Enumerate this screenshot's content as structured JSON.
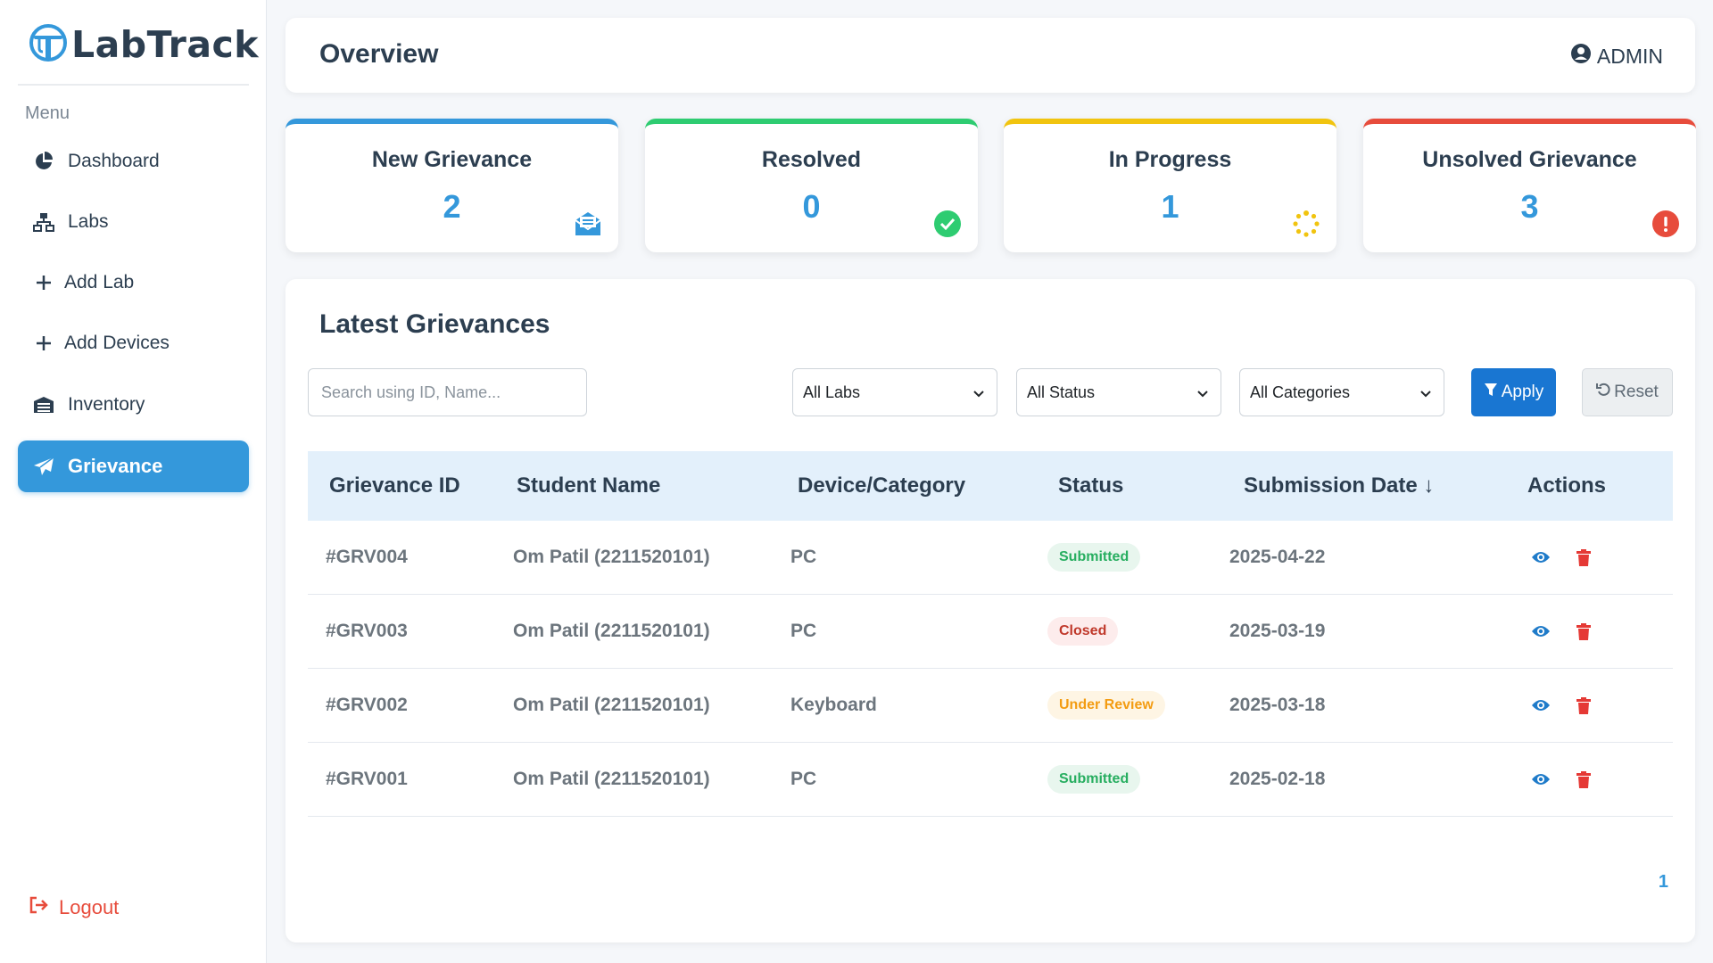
{
  "app": {
    "name": "LabTrack"
  },
  "sidebar": {
    "menu_heading": "Menu",
    "items": [
      {
        "label": "Dashboard",
        "icon": "pie-chart-icon",
        "active": false
      },
      {
        "label": "Labs",
        "icon": "network-icon",
        "active": false
      },
      {
        "label": "Add Lab",
        "icon": "plus-icon",
        "active": false
      },
      {
        "label": "Add Devices",
        "icon": "plus-icon",
        "active": false
      },
      {
        "label": "Inventory",
        "icon": "warehouse-icon",
        "active": false
      },
      {
        "label": "Grievance",
        "icon": "paper-plane-icon",
        "active": true
      }
    ],
    "logout": "Logout"
  },
  "header": {
    "title": "Overview",
    "user": "ADMIN"
  },
  "stats": [
    {
      "title": "New Grievance",
      "value": "2",
      "color": "#3498db",
      "icon": "envelope-open-icon"
    },
    {
      "title": "Resolved",
      "value": "0",
      "color": "#2ecc71",
      "icon": "check-circle-icon"
    },
    {
      "title": "In Progress",
      "value": "1",
      "color": "#f1c40f",
      "icon": "spinner-icon"
    },
    {
      "title": "Unsolved Grievance",
      "value": "3",
      "color": "#e74c3c",
      "icon": "exclamation-circle-icon"
    }
  ],
  "grievances": {
    "title": "Latest Grievances",
    "search_placeholder": "Search using ID, Name...",
    "filters": {
      "labs": "All Labs",
      "status": "All Status",
      "categories": "All Categories"
    },
    "apply_label": "Apply",
    "reset_label": "Reset",
    "columns": [
      "Grievance ID",
      "Student Name",
      "Device/Category",
      "Status",
      "Submission Date ↓",
      "Actions"
    ],
    "rows": [
      {
        "id": "#GRV004",
        "student": "Om Patil (2211520101)",
        "device": "PC",
        "status": "Submitted",
        "date": "2025-04-22"
      },
      {
        "id": "#GRV003",
        "student": "Om Patil (2211520101)",
        "device": "PC",
        "status": "Closed",
        "date": "2025-03-19"
      },
      {
        "id": "#GRV002",
        "student": "Om Patil (2211520101)",
        "device": "Keyboard",
        "status": "Under Review",
        "date": "2025-03-18"
      },
      {
        "id": "#GRV001",
        "student": "Om Patil (2211520101)",
        "device": "PC",
        "status": "Submitted",
        "date": "2025-02-18"
      }
    ],
    "page": "1"
  }
}
